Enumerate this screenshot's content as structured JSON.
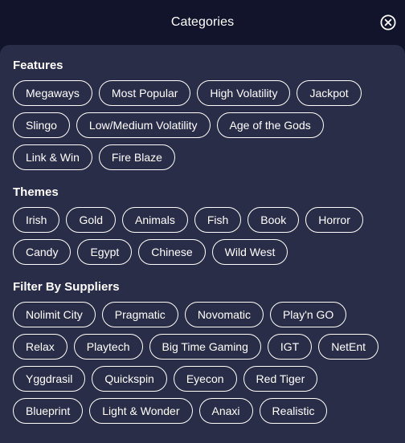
{
  "header": {
    "title": "Categories",
    "close_icon": "close-circle-icon"
  },
  "sections": [
    {
      "title": "Features",
      "items": [
        "Megaways",
        "Most Popular",
        "High Volatility",
        "Jackpot",
        "Slingo",
        "Low/Medium Volatility",
        "Age of the Gods",
        "Link & Win",
        "Fire Blaze"
      ]
    },
    {
      "title": "Themes",
      "items": [
        "Irish",
        "Gold",
        "Animals",
        "Fish",
        "Book",
        "Horror",
        "Candy",
        "Egypt",
        "Chinese",
        "Wild West"
      ]
    },
    {
      "title": "Filter By Suppliers",
      "items": [
        "Nolimit City",
        "Pragmatic",
        "Novomatic",
        "Play'n GO",
        "Relax",
        "Playtech",
        "Big Time Gaming",
        "IGT",
        "NetEnt",
        "Yggdrasil",
        "Quickspin",
        "Eyecon",
        "Red Tiger",
        "Blueprint",
        "Light & Wonder",
        "Anaxi",
        "Realistic"
      ]
    }
  ],
  "colors": {
    "header_bg": "#11142b",
    "panel_bg": "#2a2d48",
    "chip_border": "#ffffff",
    "text": "#ffffff"
  }
}
